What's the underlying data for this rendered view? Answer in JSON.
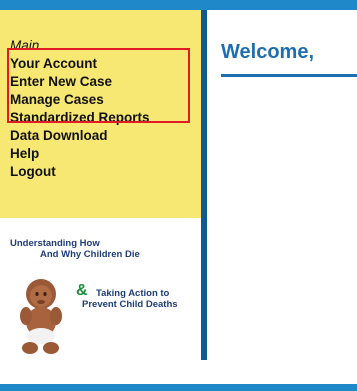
{
  "sidebar": {
    "section_label": "Main",
    "items": [
      {
        "label": "Your Account"
      },
      {
        "label": "Enter New Case"
      },
      {
        "label": "Manage Cases"
      },
      {
        "label": "Standardized Reports"
      },
      {
        "label": "Data Download"
      },
      {
        "label": "Help"
      },
      {
        "label": "Logout"
      }
    ]
  },
  "main": {
    "welcome": "Welcome,"
  },
  "promo": {
    "line1": "Understanding How",
    "line2": "And Why Children Die",
    "ampersand": "&",
    "line3": "Taking Action to",
    "line4": "Prevent Child Deaths"
  },
  "colors": {
    "header_bar": "#1e88c9",
    "sidebar_nav_bg": "#f7e873",
    "divider": "#0f5a8e",
    "welcome_text": "#1e6fb1",
    "highlight_border": "#e01b24"
  }
}
